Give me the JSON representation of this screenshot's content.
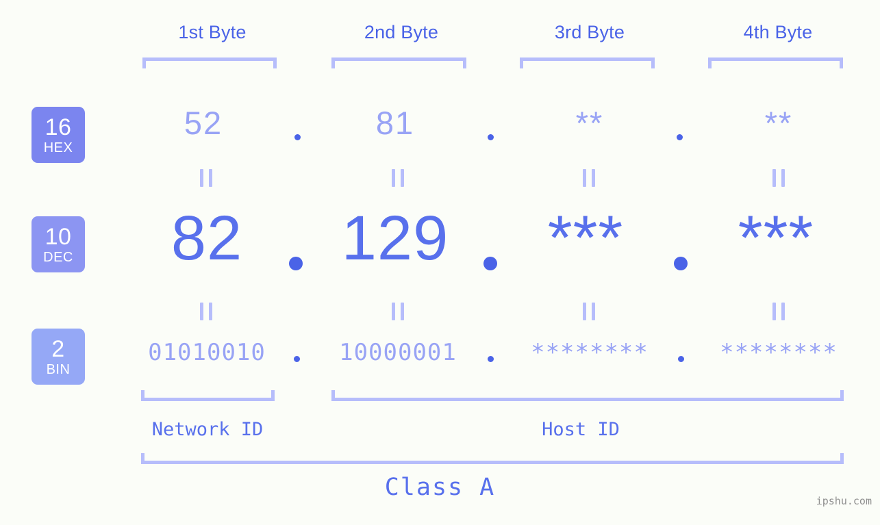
{
  "background_color": "#fbfdf8",
  "accent_color": "#4a63e7",
  "accent_light": "#98a3f5",
  "bracket_color": "#b6bdfb",
  "headers": [
    {
      "label": "1st Byte"
    },
    {
      "label": "2nd Byte"
    },
    {
      "label": "3rd Byte"
    },
    {
      "label": "4th Byte"
    }
  ],
  "radix_badges": [
    {
      "num": "16",
      "abbr": "HEX",
      "color": "#7b85ef"
    },
    {
      "num": "10",
      "abbr": "DEC",
      "color": "#8c95f2"
    },
    {
      "num": "2",
      "abbr": "BIN",
      "color": "#95a8f6"
    }
  ],
  "rows": {
    "hex": {
      "bytes": [
        "52",
        "81",
        "**",
        "**"
      ]
    },
    "dec": {
      "bytes": [
        "82",
        "129",
        "***",
        "***"
      ]
    },
    "bin": {
      "bytes": [
        "01010010",
        "10000001",
        "********",
        "********"
      ]
    }
  },
  "separator": ".",
  "id_labels": {
    "network": "Network ID",
    "host": "Host ID"
  },
  "class_label": "Class A",
  "watermark": "ipshu.com",
  "equals_symbol": "="
}
